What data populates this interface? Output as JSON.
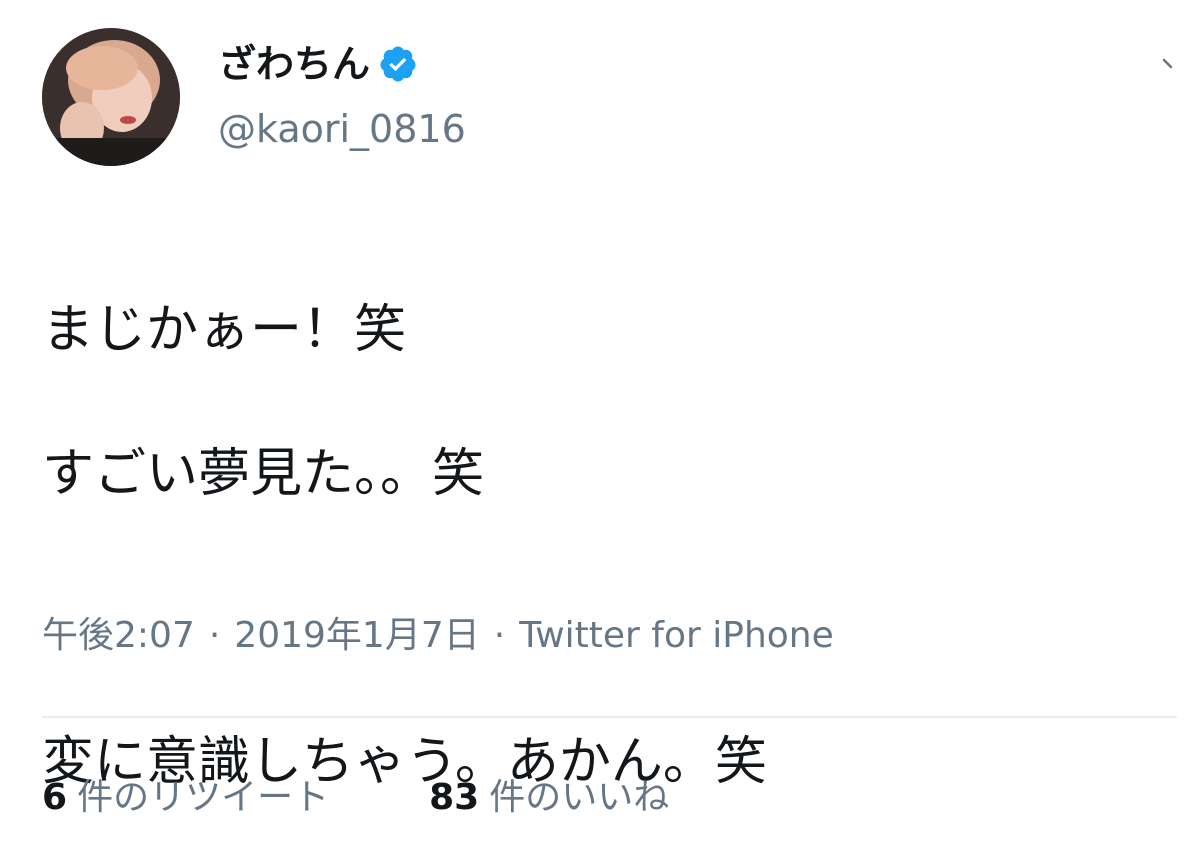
{
  "user": {
    "display_name": "ざわちん",
    "handle": "@kaori_0816",
    "verified": true,
    "avatar_icon": "avatar"
  },
  "tweet": {
    "lines": [
      "まじかぁー！笑",
      "すごい夢見た。。笑",
      "",
      "変に意識しちゃう。あかん。笑"
    ]
  },
  "meta": {
    "time": "午後2:07",
    "date": "2019年1月7日",
    "source": "Twitter for iPhone",
    "separator": "·"
  },
  "stats": {
    "retweets_count": "6",
    "retweets_label": "件のリツイート",
    "likes_count": "83",
    "likes_label": "件のいいね"
  },
  "colors": {
    "text": "#14171a",
    "secondary": "#657786",
    "verified_blue": "#1da1f2",
    "divider": "#e6ecf0"
  }
}
